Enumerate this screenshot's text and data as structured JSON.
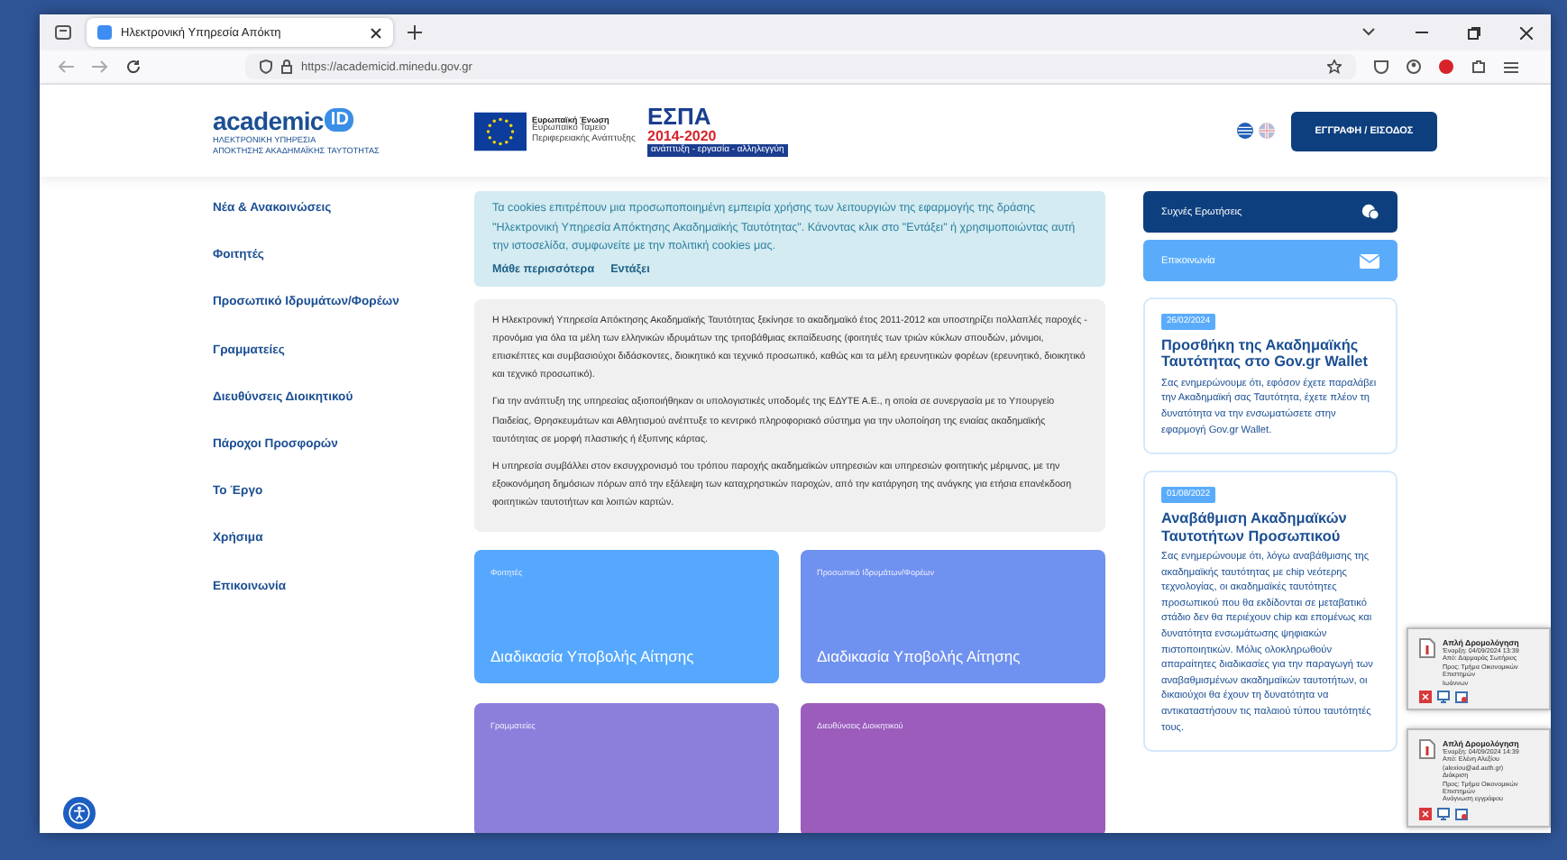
{
  "browser": {
    "tab_title": "Ηλεκτρονική Υπηρεσία Απόκτη",
    "url": "https://academicid.minedu.gov.gr"
  },
  "header": {
    "logo": {
      "word": "academic",
      "badge": "ID",
      "subtitle_lines": [
        "ΗΛΕΚΤΡΟΝΙΚΗ ΥΠΗΡΕΣΙΑ",
        "ΑΠΟΚΤΗΣΗΣ ΑΚΑΔΗΜΑΪΚΗΣ ΤΑΥΤΟΤΗΤΑΣ"
      ]
    },
    "eu_logo": {
      "name": "Ευρωπαϊκή Ένωση",
      "note": "Ευρωπαϊκό Ταμείο Περιφερειακής Ανάπτυξης"
    },
    "espa_logo": {
      "title": "ΕΣΠΑ",
      "years": "2014-2020",
      "tagline": "ανάπτυξη - εργασία - αλληλεγγύη"
    },
    "languages": [
      {
        "kind": "greek",
        "selected": true
      },
      {
        "kind": "english",
        "selected": false
      }
    ],
    "login_button": "ΕΓΓΡΑΦΗ / ΕΙΣΟΔΟΣ"
  },
  "sidebar": {
    "items": [
      "Νέα & Ανακοινώσεις",
      "Φοιτητές",
      "Προσωπικό Ιδρυμάτων/Φορέων",
      "Γραμματείες",
      "Διευθύνσεις Διοικητικού",
      "Πάροχοι Προσφορών",
      "Το Έργο",
      "Χρήσιμα",
      "Επικοινωνία"
    ]
  },
  "cookie_notice": {
    "text": "Τα cookies επιτρέπουν μια προσωποποιημένη εμπειρία χρήσης των λειτουργιών της εφαρμογής της δράσης \"Ηλεκτρονική Υπηρεσία Απόκτησης Ακαδημαϊκής Ταυτότητας\". Κάνοντας κλικ στο \"Εντάξει\" ή χρησιμοποιώντας αυτή την ιστοσελίδα, συμφωνείτε με την πολιτική cookies μας.",
    "links": [
      "Μάθε περισσότερα",
      "Εντάξει"
    ]
  },
  "intro": {
    "paragraphs": [
      "Η Ηλεκτρονική Υπηρεσία Απόκτησης Ακαδημαϊκής Ταυτότητας ξεκίνησε το ακαδημαϊκό έτος 2011-2012 και υποστηρίζει πολλαπλές παροχές - προνόμια για όλα τα μέλη των ελληνικών ιδρυμάτων της τριτοβάθμιας εκπαίδευσης (φοιτητές των τριών κύκλων σπουδών, μόνιμοι, επισκέπτες και συμβασιούχοι διδάσκοντες, διοικητικό και τεχνικό προσωπικό, καθώς και τα μέλη ερευνητικών φορέων (ερευνητικό, διοικητικό και τεχνικό προσωπικό).",
      "Για την ανάπτυξη της υπηρεσίας αξιοποιήθηκαν οι υπολογιστικές υποδομές της ΕΔΥΤΕ Α.Ε., η οποία σε συνεργασία με το Υπουργείο Παιδείας, Θρησκευμάτων και Αθλητισμού ανέπτυξε το κεντρικό πληροφοριακό σύστημα για την υλοποίηση της ενιαίας ακαδημαϊκής ταυτότητας σε μορφή πλαστικής ή έξυπνης κάρτας.",
      "Η υπηρεσία συμβάλλει στον εκσυγχρονισμό του τρόπου παροχής ακαδημαϊκών υπηρεσιών και υπηρεσιών φοιτητικής μέριμνας, με την εξοικονόμηση δημόσιων πόρων από την εξάλειψη των καταχρηστικών παροχών, από την κατάργηση της ανάγκης για ετήσια επανέκδοση φοιτητικών ταυτοτήτων και λοιπών καρτών."
    ]
  },
  "tiles": [
    {
      "label": "Φοιτητές",
      "title": "Διαδικασία Υποβολής Αίτησης",
      "color": "#55a8fd"
    },
    {
      "label": "Προσωπικό Ιδρυμάτων/Φορέων",
      "title": "Διαδικασία Υποβολής Αίτησης",
      "color": "#6f91ef"
    },
    {
      "label": "Γραμματείες",
      "color": "#8b7fdb"
    },
    {
      "label": "Διευθύνσεις Διοικητικού",
      "color": "#9b5cbb"
    }
  ],
  "quick_links": [
    {
      "kind": "faq",
      "label": "Συχνές Ερωτήσεις"
    },
    {
      "kind": "contact",
      "label": "Επικοινωνία"
    }
  ],
  "news": [
    {
      "date": "26/02/2024",
      "title": "Προσθήκη της Ακαδημαϊκής Ταυτότητας στο Gov.gr Wallet",
      "body": "Σας ενημερώνουμε ότι, εφόσον έχετε παραλάβει την Ακαδημαϊκή σας Ταυτότητα, έχετε πλέον τη δυνατότητα να την ενσωματώσετε στην εφαρμογή Gov.gr Wallet."
    },
    {
      "date": "01/08/2022",
      "title": "Αναβάθμιση Ακαδημαϊκών Ταυτοτήτων Προσωπικού",
      "body": "Σας ενημερώνουμε ότι, λόγω αναβάθμισης της ακαδημαϊκής ταυτότητας με chip νεότερης τεχνολογίας, οι ακαδημαϊκές ταυτότητες προσωπικού που θα εκδίδονται σε μεταβατικό στάδιο δεν θα περιέχουν chip και επομένως και δυνατότητα ενσωμάτωσης ψηφιακών πιστοποιητικών. Μόλις ολοκληρωθούν απαραίτητες διαδικασίες για την παραγωγή των αναβαθμισμένων ακαδημαϊκών ταυτοτήτων, οι δικαιούχοι θα έχουν τη δυνατότητα να αντικαταστήσουν τις παλαιού τύπου ταυτότητές τους."
    }
  ],
  "notifications": [
    {
      "title": "Απλή Δρομολόγηση",
      "lines": [
        "Έναρξη: 04/09/2024 13:39",
        "Από: Δαρμαράς Σωτήριος",
        "Προς: Τμήμα Οικονομικών Επιστημών",
        "Ιωάννων"
      ]
    },
    {
      "title": "Απλή Δρομολόγηση",
      "lines": [
        "Έναρξη: 04/09/2024 14:39",
        "Από: Ελένη Αλεξίου (alexiou@ad.auth.gr)",
        "Διάκριση",
        "Προς: Τμήμα Οικονομικών Επιστημών",
        "Ανάγνωση εγγράφου"
      ]
    }
  ]
}
